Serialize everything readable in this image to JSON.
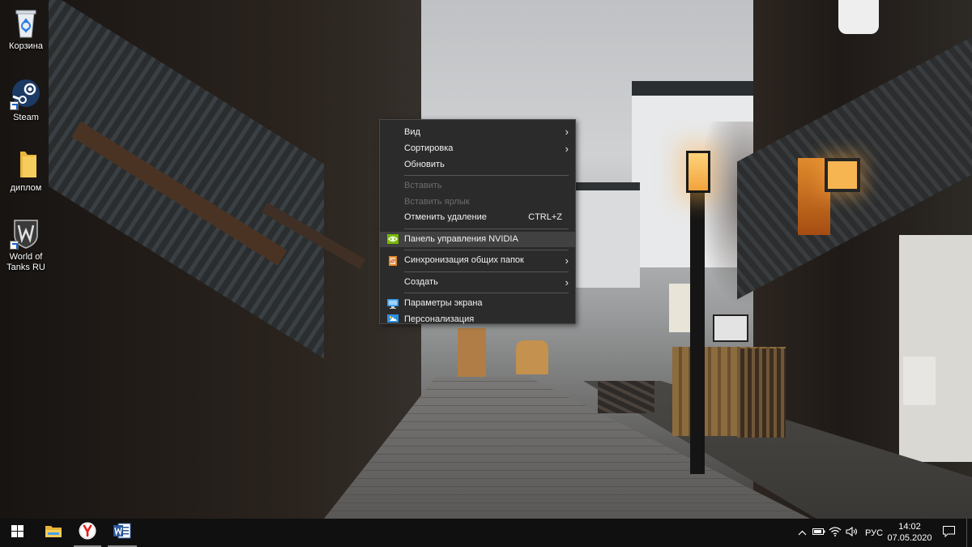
{
  "desktop": {
    "icons": [
      {
        "label": "Корзина",
        "icon": "recycle-bin-icon"
      },
      {
        "label": "Steam",
        "icon": "steam-icon"
      },
      {
        "label": "диплом",
        "icon": "folder-icon"
      },
      {
        "label": "World of Tanks RU",
        "icon": "world-of-tanks-icon"
      }
    ]
  },
  "context_menu": {
    "items": [
      {
        "label": "Вид",
        "submenu": true
      },
      {
        "label": "Сортировка",
        "submenu": true
      },
      {
        "label": "Обновить"
      },
      {
        "label": "Вставить",
        "disabled": true
      },
      {
        "label": "Вставить ярлык",
        "disabled": true
      },
      {
        "label": "Отменить удаление",
        "shortcut": "CTRL+Z"
      },
      {
        "label": "Панель управления NVIDIA",
        "icon": "nvidia-icon",
        "highlighted": true
      },
      {
        "label": "Синхронизация общих папок",
        "icon": "sync-folders-icon",
        "submenu": true
      },
      {
        "label": "Создать",
        "submenu": true
      },
      {
        "label": "Параметры экрана",
        "icon": "display-settings-icon"
      },
      {
        "label": "Персонализация",
        "icon": "personalization-icon"
      }
    ]
  },
  "taskbar": {
    "pinned": [
      {
        "name": "start",
        "icon": "windows-logo-icon"
      },
      {
        "name": "file-explorer",
        "icon": "file-explorer-icon"
      },
      {
        "name": "yandex-browser",
        "icon": "yandex-browser-icon"
      },
      {
        "name": "word",
        "icon": "word-icon"
      }
    ],
    "tray": {
      "language": "РУС",
      "time": "14:02",
      "date": "07.05.2020"
    }
  },
  "colors": {
    "menu_bg": "#2b2b2b",
    "menu_highlight": "#414141",
    "taskbar_bg": "#101010",
    "nvidia_green": "#76b900"
  }
}
